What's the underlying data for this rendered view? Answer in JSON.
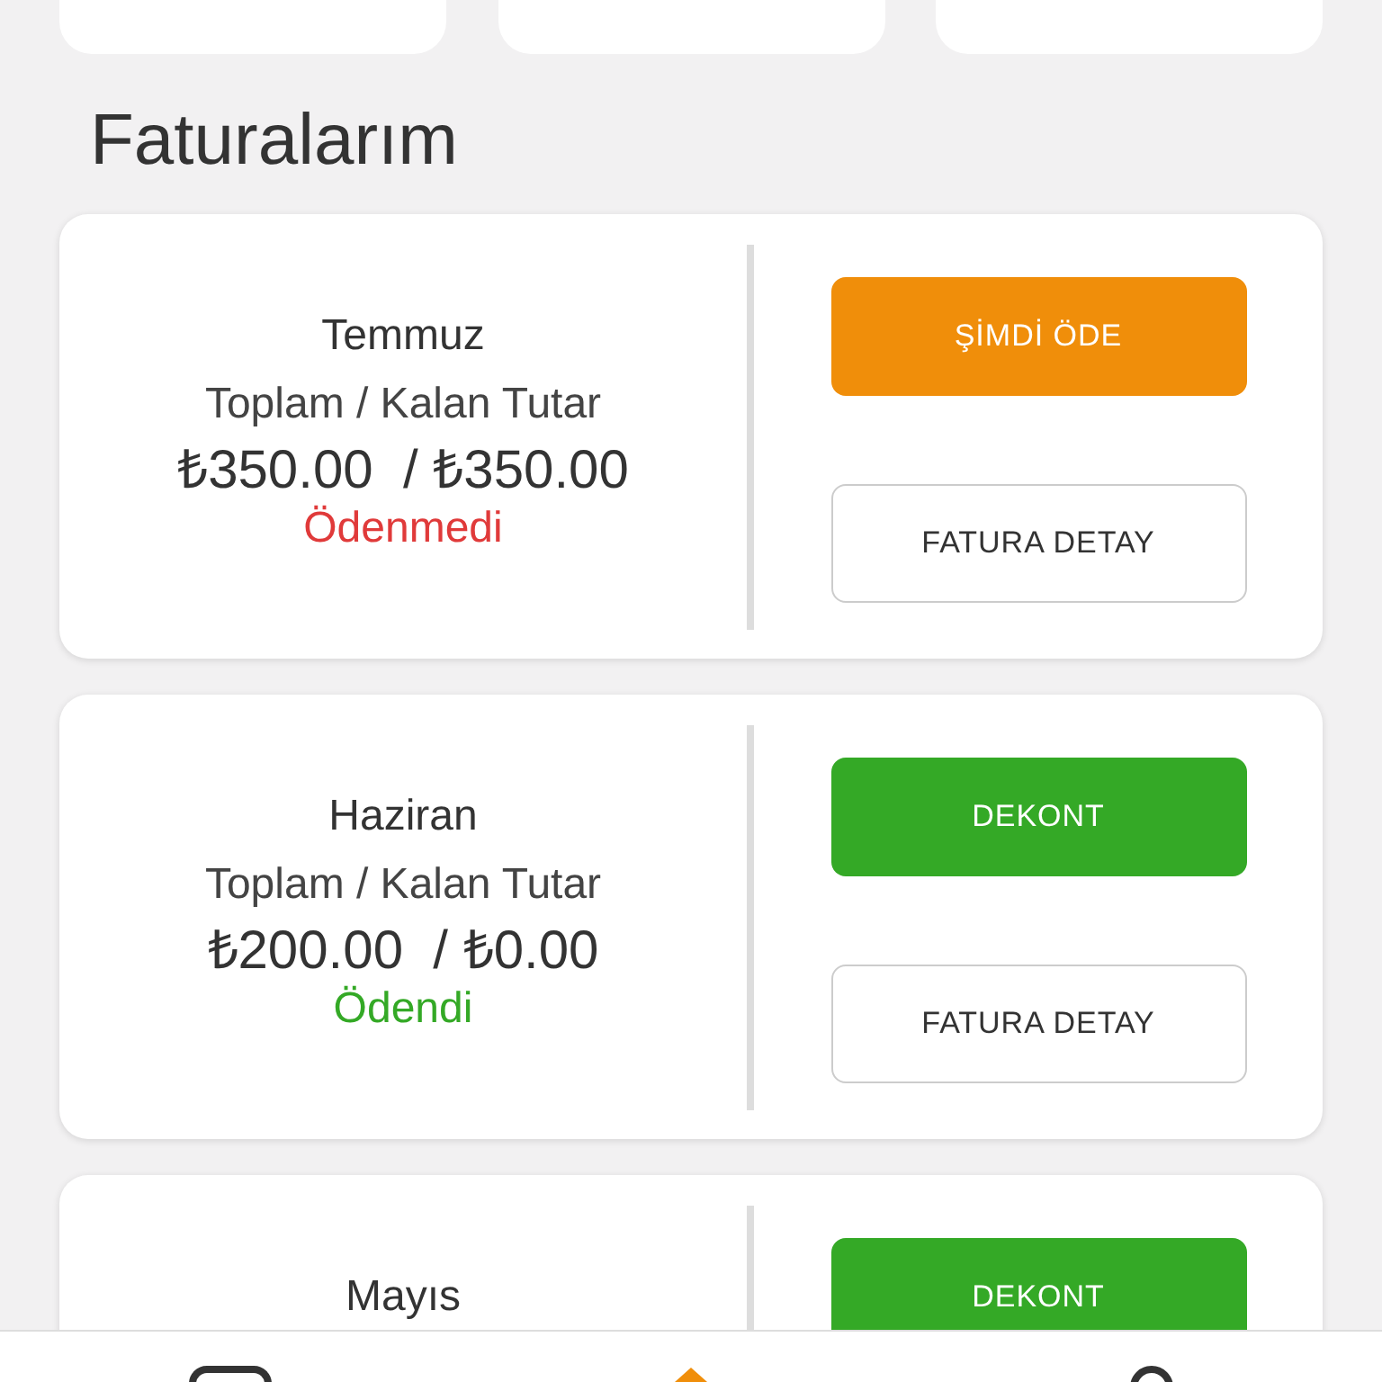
{
  "title": "Faturalarım",
  "invoices": [
    {
      "month": "Temmuz",
      "label": "Toplam / Kalan Tutar",
      "amounts": "₺350.00  / ₺350.00",
      "status": "Ödenmedi",
      "paid": false,
      "buttons": [
        {
          "kind": "pay",
          "label": "ŞİMDİ ÖDE"
        },
        {
          "kind": "detail",
          "label": "FATURA DETAY"
        }
      ]
    },
    {
      "month": "Haziran",
      "label": "Toplam / Kalan Tutar",
      "amounts": "₺200.00  / ₺0.00",
      "status": "Ödendi",
      "paid": true,
      "buttons": [
        {
          "kind": "receipt",
          "label": "DEKONT"
        },
        {
          "kind": "detail",
          "label": "FATURA DETAY"
        }
      ]
    },
    {
      "month": "Mayıs",
      "buttons": [
        {
          "kind": "receipt",
          "label": "DEKONT"
        }
      ]
    }
  ],
  "tab_bar": [
    {
      "kind": "card",
      "selected": false
    },
    {
      "kind": "home",
      "selected": true
    },
    {
      "kind": "user",
      "selected": false
    }
  ]
}
